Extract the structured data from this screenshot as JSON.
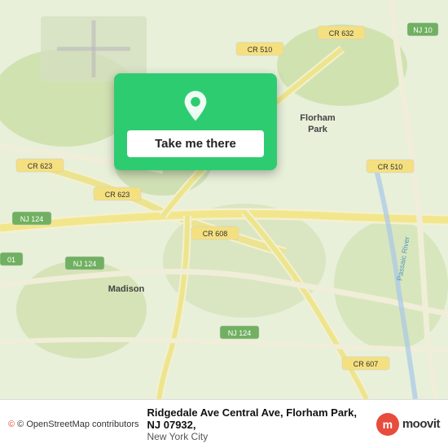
{
  "map": {
    "background_color": "#e8f0e0",
    "alt": "Map of Florham Park, NJ area"
  },
  "popup": {
    "button_label": "Take me there",
    "bg_color": "#2ecc71",
    "pin_color": "white"
  },
  "bottom_bar": {
    "osm_attribution": "© OpenStreetMap contributors",
    "address_line1": "Ridgedale Ave Central Ave, Florham Park, NJ 07932,",
    "address_line2": "New York City",
    "moovit_label": "moovit"
  }
}
